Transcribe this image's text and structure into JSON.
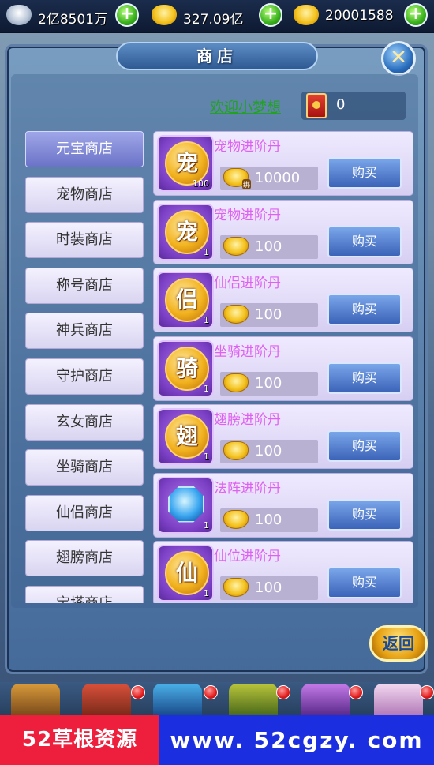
{
  "currency": {
    "silver": {
      "icon": "silver-coin-icon",
      "value": "2亿8501万"
    },
    "gold": {
      "icon": "gold-ingot-icon",
      "value": "327.09亿"
    },
    "bound_gold": {
      "icon": "bound-gold-ingot-icon",
      "value": "20001588"
    },
    "add_symbol": "+"
  },
  "window": {
    "title": "商店",
    "close_symbol": "✕",
    "back_label": "返回"
  },
  "player": {
    "name": "欢迎小梦想",
    "redpack_count": "0"
  },
  "tabs": [
    {
      "label": "元宝商店",
      "active": true
    },
    {
      "label": "宠物商店"
    },
    {
      "label": "时装商店"
    },
    {
      "label": "称号商店"
    },
    {
      "label": "神兵商店"
    },
    {
      "label": "守护商店"
    },
    {
      "label": "玄女商店"
    },
    {
      "label": "坐骑商店"
    },
    {
      "label": "仙侣商店"
    },
    {
      "label": "翅膀商店"
    },
    {
      "label": "宝塔商店"
    }
  ],
  "items": [
    {
      "name": "宠物进阶丹",
      "glyph": "宠",
      "qty": "100",
      "price": "10000",
      "currency": "bound",
      "buy": "购买"
    },
    {
      "name": "宠物进阶丹",
      "glyph": "宠",
      "qty": "1",
      "price": "100",
      "currency": "gold",
      "buy": "购买"
    },
    {
      "name": "仙侣进阶丹",
      "glyph": "侣",
      "qty": "1",
      "price": "100",
      "currency": "gold",
      "buy": "购买"
    },
    {
      "name": "坐骑进阶丹",
      "glyph": "骑",
      "qty": "1",
      "price": "100",
      "currency": "gold",
      "buy": "购买"
    },
    {
      "name": "翅膀进阶丹",
      "glyph": "翅",
      "qty": "1",
      "price": "100",
      "currency": "gold",
      "buy": "购买"
    },
    {
      "name": "法阵进阶丹",
      "glyph": "",
      "qty": "1",
      "price": "100",
      "currency": "gold",
      "buy": "购买",
      "gem": true
    },
    {
      "name": "仙位进阶丹",
      "glyph": "仙",
      "qty": "1",
      "price": "100",
      "currency": "gold",
      "buy": "购买"
    }
  ],
  "colors": {
    "item_name": "#e060f0",
    "player_name": "#1fa41c",
    "active_tab": "#7e86d6",
    "watermark_red": "#ee1f3c",
    "watermark_blue": "#1b2fe0"
  },
  "watermark": {
    "left": "52草根资源",
    "right": "www. 52cgzy. com"
  }
}
